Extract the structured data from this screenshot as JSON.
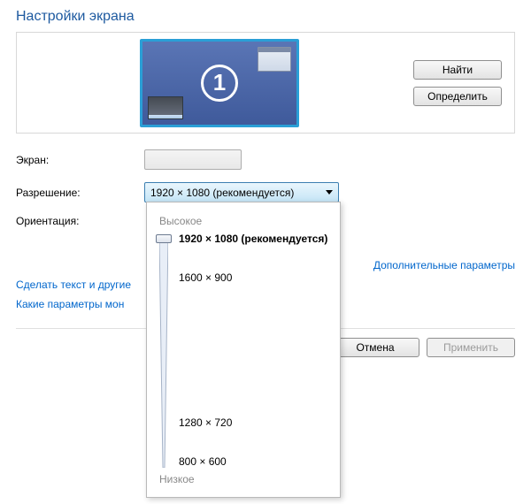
{
  "title": "Настройки экрана",
  "monitor": {
    "number": "1"
  },
  "buttons": {
    "find": "Найти",
    "identify": "Определить",
    "cancel": "Отмена",
    "apply": "Применить"
  },
  "labels": {
    "screen": "Экран:",
    "resolution": "Разрешение:",
    "orientation": "Ориентация:"
  },
  "dropdown": {
    "resolution_value": "1920 × 1080 (рекомендуется)"
  },
  "links": {
    "advanced": "Дополнительные параметры",
    "text_size": "Сделать текст и другие",
    "monitor_params": "Какие параметры мон"
  },
  "popup": {
    "high": "Высокое",
    "low": "Низкое",
    "options": [
      {
        "label": "1920 × 1080 (рекомендуется)",
        "selected": true,
        "pos": 0
      },
      {
        "label": "1600 × 900",
        "selected": false,
        "pos": 44
      },
      {
        "label": "1280 × 720",
        "selected": false,
        "pos": 208
      },
      {
        "label": "800 × 600",
        "selected": false,
        "pos": 252
      }
    ]
  }
}
